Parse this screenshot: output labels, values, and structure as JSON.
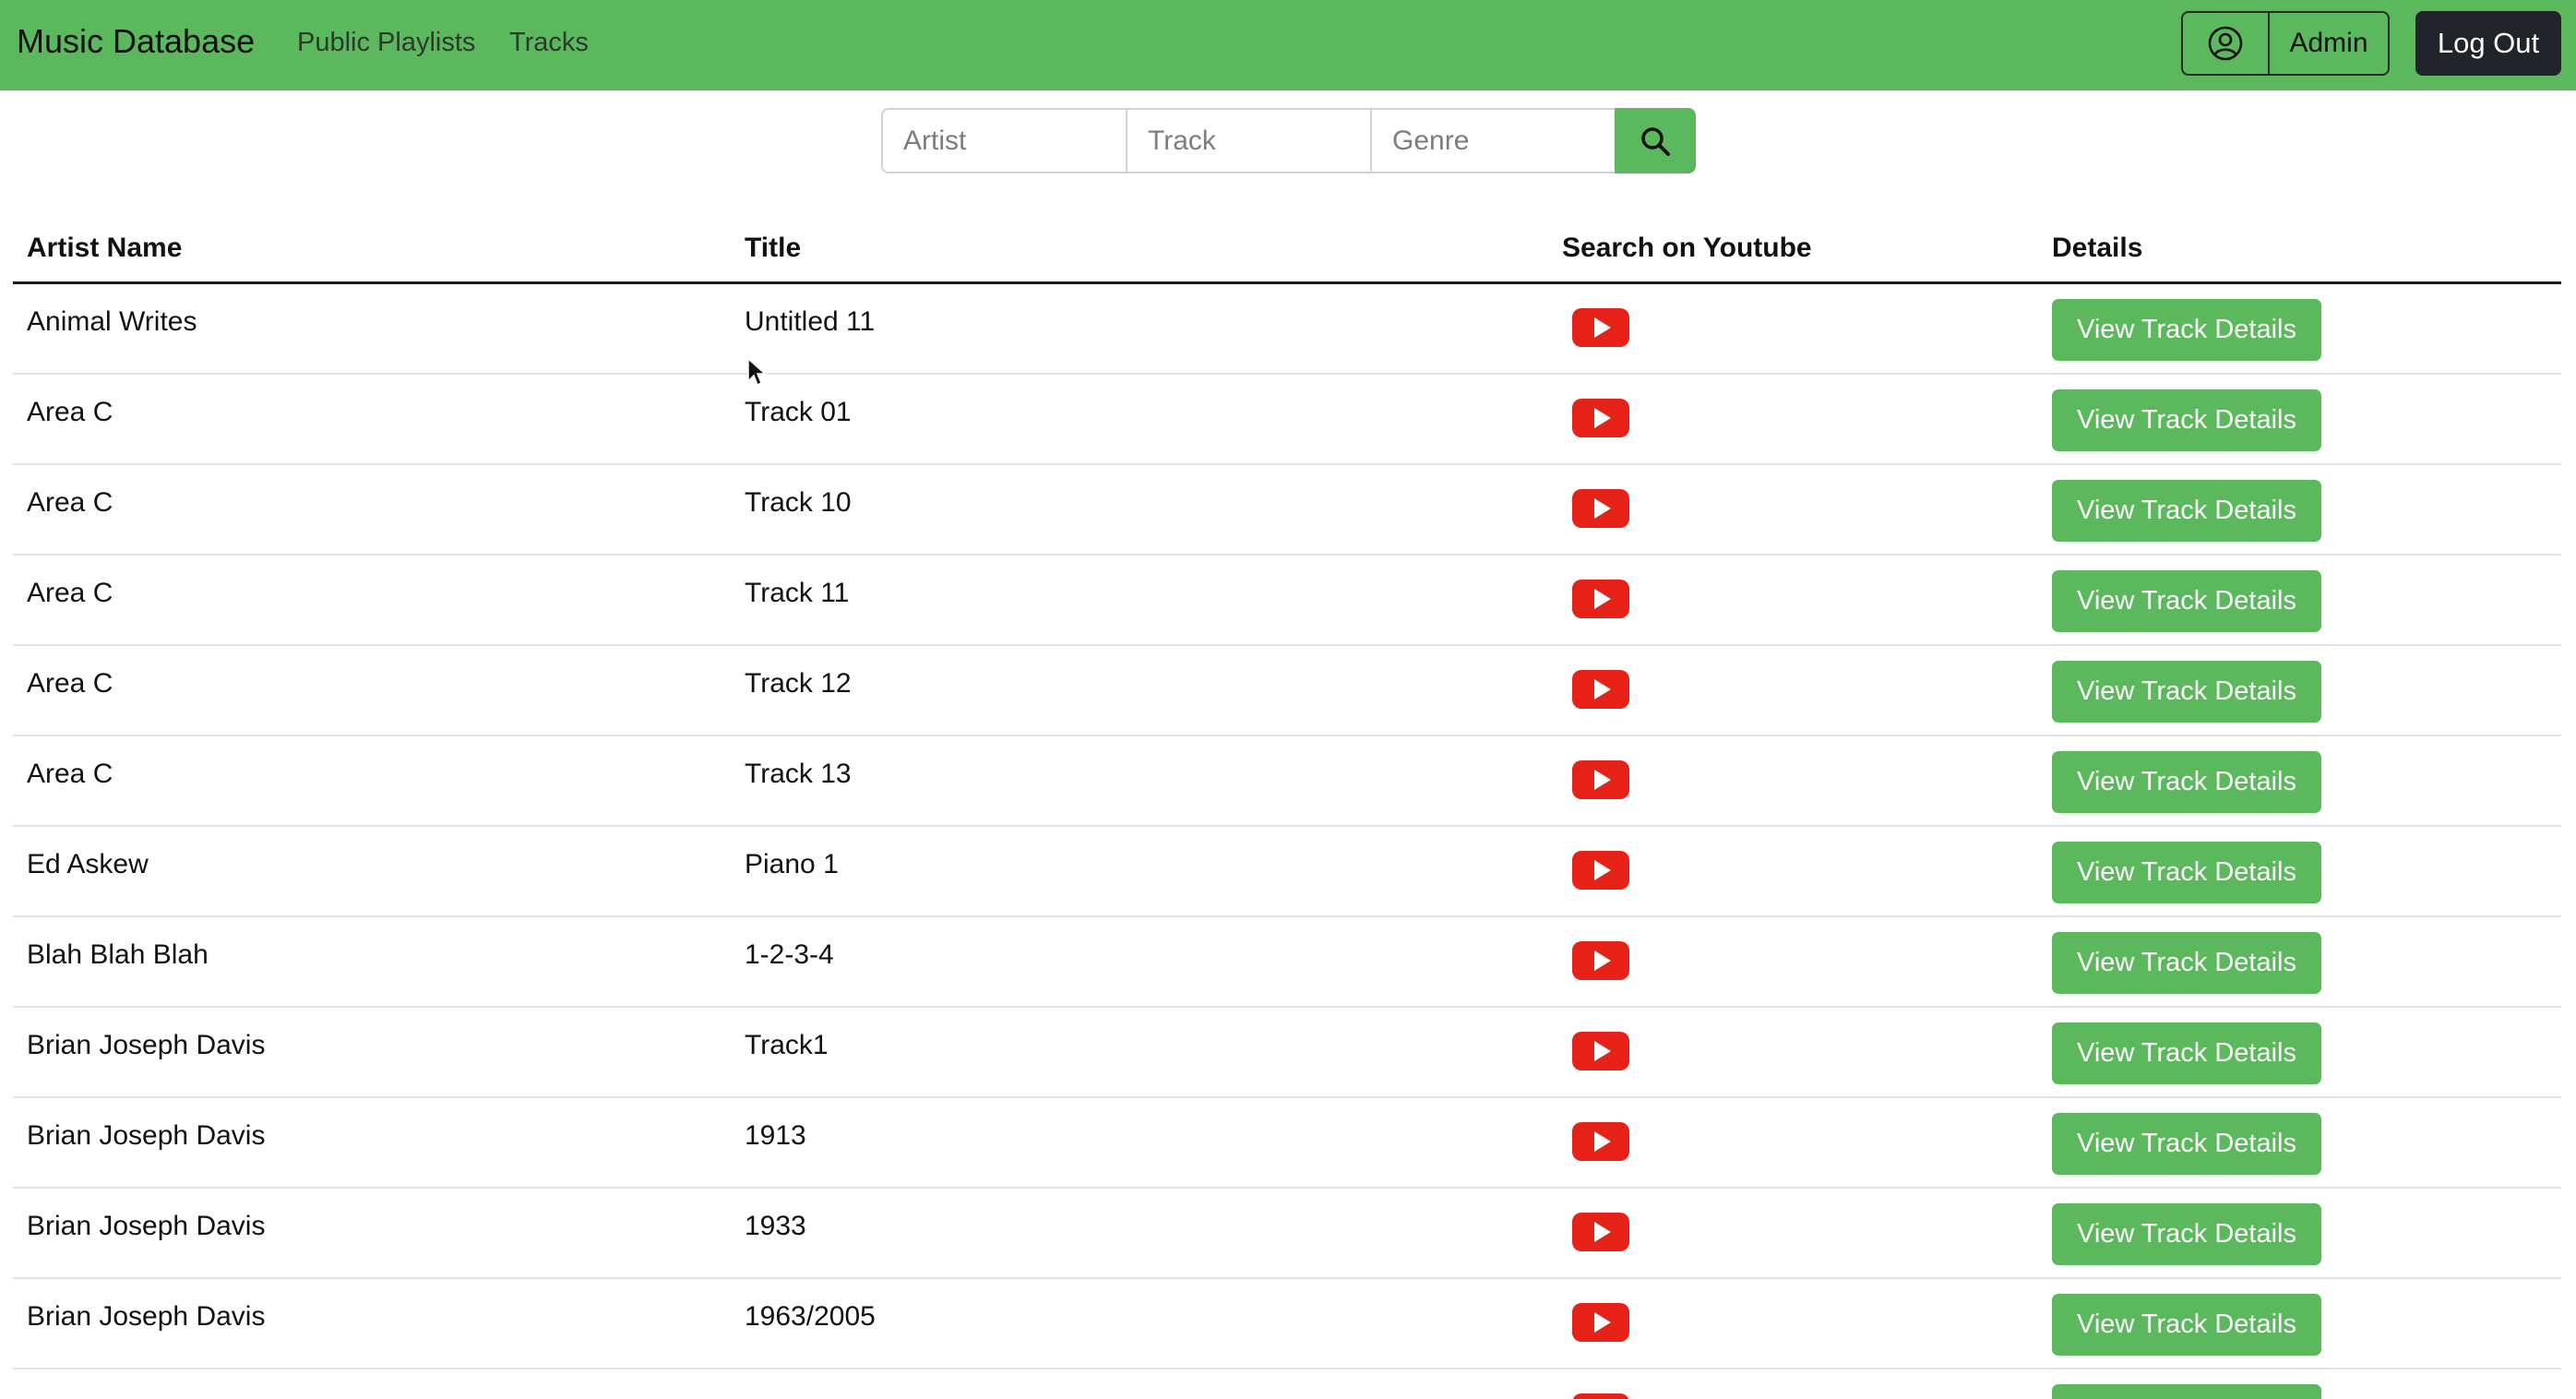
{
  "nav": {
    "brand": "Music Database",
    "links": [
      "Public Playlists",
      "Tracks"
    ],
    "admin_label": "Admin",
    "logout_label": "Log Out"
  },
  "search": {
    "artist_placeholder": "Artist",
    "track_placeholder": "Track",
    "genre_placeholder": "Genre"
  },
  "table": {
    "headers": [
      "Artist Name",
      "Title",
      "Search on Youtube",
      "Details"
    ],
    "button_label": "View Track Details",
    "rows": [
      {
        "artist": "Animal Writes",
        "title": "Untitled 11"
      },
      {
        "artist": "Area C",
        "title": "Track 01"
      },
      {
        "artist": "Area C",
        "title": "Track 10"
      },
      {
        "artist": "Area C",
        "title": "Track 11"
      },
      {
        "artist": "Area C",
        "title": "Track 12"
      },
      {
        "artist": "Area C",
        "title": "Track 13"
      },
      {
        "artist": "Ed Askew",
        "title": "Piano 1"
      },
      {
        "artist": "Blah Blah Blah",
        "title": "1-2-3-4"
      },
      {
        "artist": "Brian Joseph Davis",
        "title": "Track1"
      },
      {
        "artist": "Brian Joseph Davis",
        "title": "1913"
      },
      {
        "artist": "Brian Joseph Davis",
        "title": "1933"
      },
      {
        "artist": "Brian Joseph Davis",
        "title": "1963/2005"
      }
    ]
  },
  "icons": {
    "user": "user-circle-icon",
    "search": "search-icon",
    "youtube": "youtube-icon"
  },
  "colors": {
    "primary_green": "#5cb85c",
    "dark": "#212529",
    "youtube_red": "#e62117"
  }
}
